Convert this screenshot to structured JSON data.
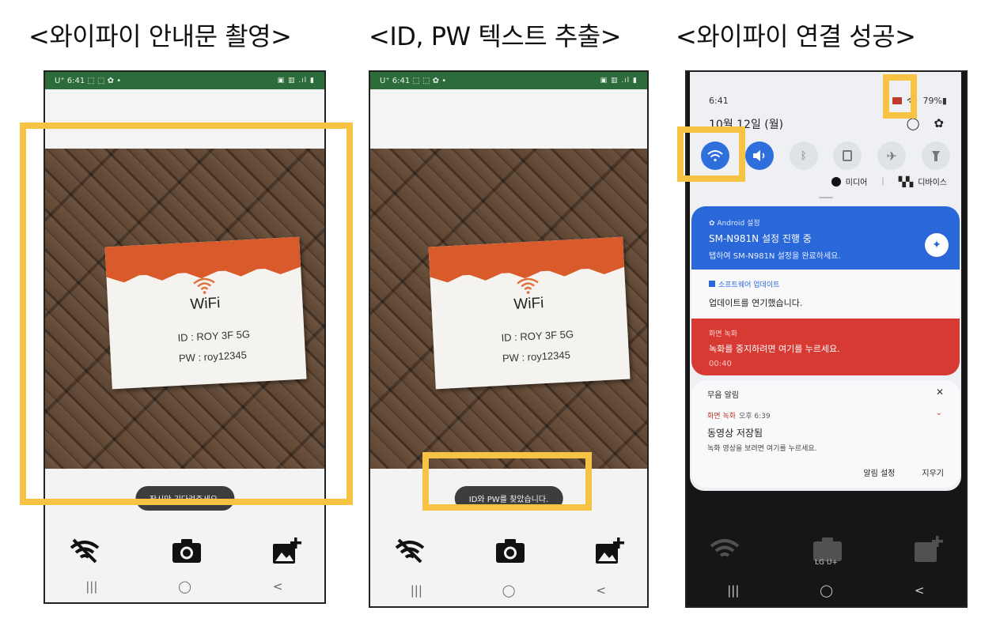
{
  "captions": [
    "<와이파이 안내문 촬영>",
    "<ID, PW 텍스트 추출>",
    "<와이파이 연결 성공>"
  ],
  "phone1": {
    "status_left": "U⁺ 6:41 ⬚ ⬚ ✿ •",
    "status_right": "▣ ▥ .ıl ▮",
    "sign": {
      "title": "WiFi",
      "id_line": "ID : ROY 3F 5G",
      "pw_line": "PW : roy12345"
    },
    "toast": "잠시만 기다려주세요.",
    "nav": [
      "|||",
      "◯",
      "<"
    ]
  },
  "phone2": {
    "status_left": "U⁺ 6:41 ⬚ ⬚ ✿ •",
    "status_right": "▣ ▥ .ıl ▮",
    "sign": {
      "title": "WiFi",
      "id_line": "ID : ROY 3F 5G",
      "pw_line": "PW : roy12345"
    },
    "toast": "ID와 PW를 찾았습니다.",
    "nav": [
      "|||",
      "◯",
      "<"
    ]
  },
  "phone3": {
    "time": "6:41",
    "status_right": "79%▮",
    "date": "10월 12일 (월)",
    "media_label": "미디어",
    "devices_label": "디바이스",
    "notifications": {
      "android": {
        "app": "✿ Android 설정",
        "title": "SM-N981N 설정 진행 중",
        "body": "탭하여 SM-N981N 설정을 완료하세요."
      },
      "update": {
        "app": "소프트웨어 업데이트",
        "title": "업데이트를 연기했습니다."
      },
      "recording": {
        "app": "화면 녹화",
        "title": "녹화를 중지하려면 여기를 누르세요.",
        "elapsed": "00:40"
      },
      "silent": {
        "header": "무음 알림",
        "sub_app": "화면 녹화",
        "sub_time": "오후 6:39",
        "title": "동영상 저장됨",
        "body": "녹화 영상을 보려면 여기를 누르세요.",
        "settings_label": "알림 설정",
        "clear_label": "지우기"
      }
    },
    "carrier_label": "LG U+",
    "nav": [
      "|||",
      "◯",
      "<"
    ]
  },
  "highlight_color": "#f6c344",
  "quick_setting_active_color": "#2f6fdc"
}
